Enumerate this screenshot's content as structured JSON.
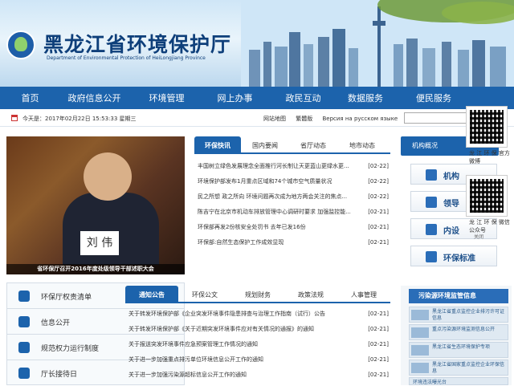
{
  "header": {
    "title": "黑龙江省环境保护厅",
    "subtitle": "Department of Environmental Protection of HeiLongjiang Province"
  },
  "nav": {
    "items": [
      "首页",
      "政府信息公开",
      "环境管理",
      "网上办事",
      "政民互动",
      "数据服务",
      "便民服务"
    ]
  },
  "infobar": {
    "date": "今天是：2017年02月22日 15:53:33 星期三",
    "links": [
      "网站地图",
      "繁體版",
      "Версия на русском языке"
    ]
  },
  "photo": {
    "nameplate": "刘 伟",
    "caption": "省环保厅召开2016年度处级领导干部述职大会"
  },
  "news": {
    "tabs": [
      "环保快讯",
      "国内要闻",
      "省厅动态",
      "地市动态"
    ],
    "items": [
      {
        "title": "丰国树立绿色发展理念全面推行河长制让天更蓝山更绿水更...",
        "date": "[02-22]"
      },
      {
        "title": "环境保护部发布1月重点区域和74个城市空气质量状况",
        "date": "[02-22]"
      },
      {
        "title": "民之所想 政之所向 环境问题再次成为地方两会关注的焦点...",
        "date": "[02-22]"
      },
      {
        "title": "陈吉宁在北京市机动车排放管理中心调研时要求 加强监控能...",
        "date": "[02-21]"
      },
      {
        "title": "环保部再发2份核安全处罚书 去年已发16份",
        "date": "[02-21]"
      },
      {
        "title": "环保部:自然生态保护工作成效显现",
        "date": "[02-21]"
      }
    ]
  },
  "org": {
    "header": "机构概况",
    "buttons": [
      "机构",
      "领导",
      "内设",
      "环保标准"
    ]
  },
  "qr": {
    "label1": "龙 江 环 保 官方微博",
    "label2": "龙 江 环 保 微信公众号",
    "close": "关闭"
  },
  "left_list": {
    "items": [
      "环保厅权责清单",
      "信息公开",
      "规范权力运行制度",
      "厅长接待日"
    ]
  },
  "notice": {
    "tabs": [
      "通知公告",
      "环保公文",
      "规划财务",
      "政策法规",
      "人事管理"
    ],
    "items": [
      {
        "title": "关于转发环境保护部《企业突发环境事件隐患排查与治理工作指南（试行）公告",
        "date": "[02-21]"
      },
      {
        "title": "关于转发环境保护部《关于近期突发环境事件应对有关情况的通报》的通知",
        "date": "[02-21]"
      },
      {
        "title": "关于报送突发环境事件应急预案管理工作情况的通知",
        "date": "[02-21]"
      },
      {
        "title": "关于进一步加强重点排污单位环境信息公开工作的通知",
        "date": "[02-21]"
      },
      {
        "title": "关于进一步加强污染源超标信息公开工作的通知",
        "date": "[02-21]"
      }
    ]
  },
  "pollution": {
    "header": "污染源环境监管信息",
    "items": [
      "黑龙江省重点监控企业排污许可证信息",
      "重点污染源环境监测信息公开",
      "黑龙江省生态环境保护专项",
      "黑龙江省国家重点监控企业环保信息",
      "环境违法曝光台"
    ]
  }
}
